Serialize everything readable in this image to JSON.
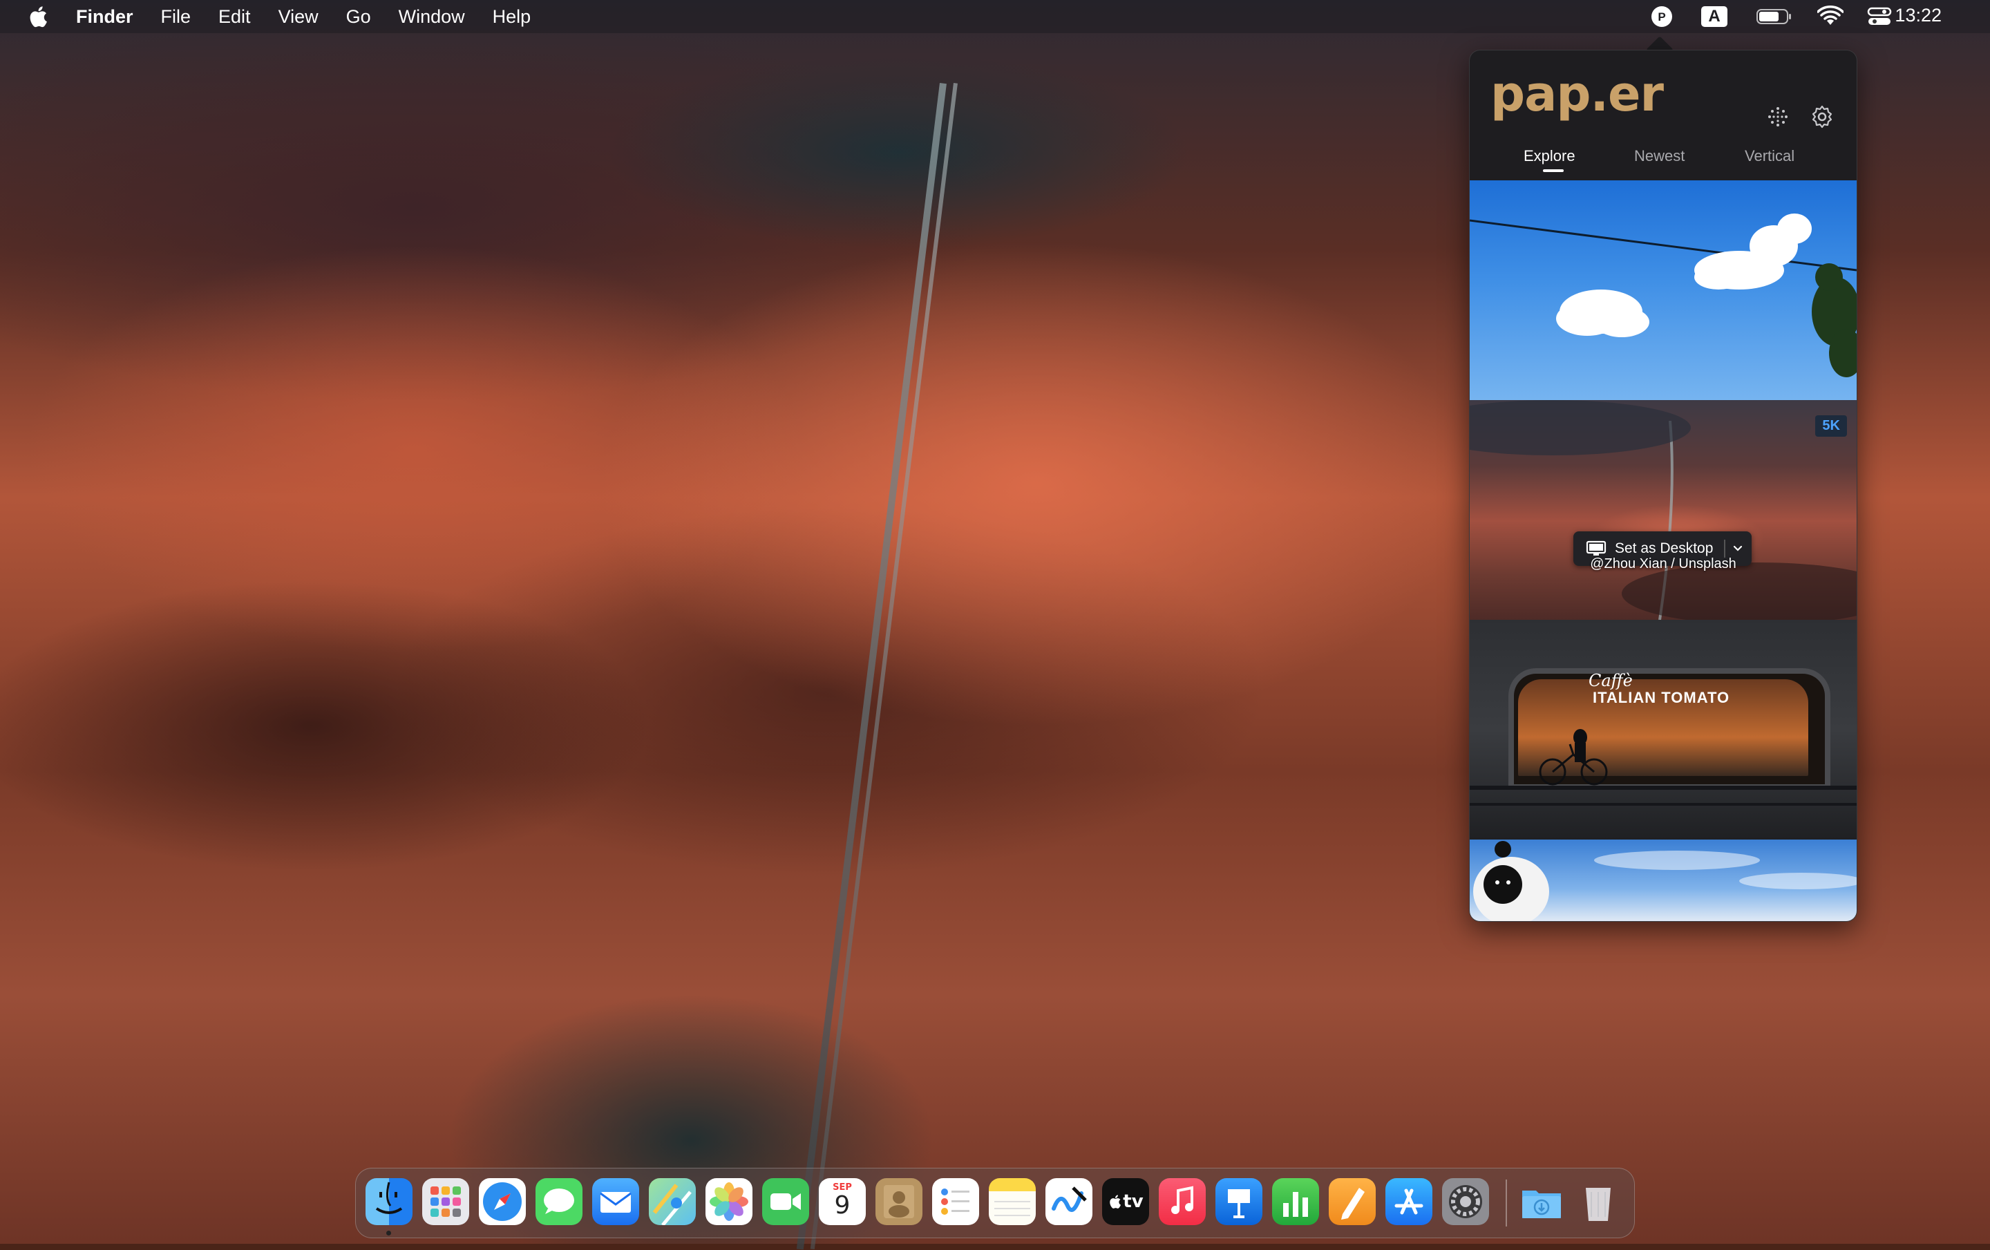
{
  "menubar": {
    "app_name": "Finder",
    "menus": [
      "File",
      "Edit",
      "View",
      "Go",
      "Window",
      "Help"
    ],
    "clock": "13:22",
    "input_source": "A",
    "status_icons": [
      "paper-app-icon",
      "input-source-icon",
      "battery-icon",
      "wifi-icon",
      "control-center-icon"
    ]
  },
  "popover": {
    "logo": "pap.er",
    "tabs": [
      {
        "label": "Explore",
        "active": true
      },
      {
        "label": "Newest",
        "active": false
      },
      {
        "label": "Vertical",
        "active": false
      }
    ],
    "thumbnails": [
      {
        "id": "sky-clouds"
      },
      {
        "id": "red-desert-road",
        "badge": "5K",
        "set_button": "Set as Desktop",
        "credit": "@Zhou Xian / Unsplash"
      },
      {
        "id": "caffe-italian-tomato",
        "sign_script": "Caffè",
        "sign": "ITALIAN TOMATO"
      },
      {
        "id": "sky-toy"
      }
    ]
  },
  "dock": {
    "apps": [
      "Finder",
      "Launchpad",
      "Safari",
      "Messages",
      "Mail",
      "Maps",
      "Photos",
      "FaceTime",
      "Calendar",
      "Contacts",
      "Reminders",
      "Notes",
      "Freeform",
      "TV",
      "Music",
      "Keynote",
      "Numbers",
      "Pages",
      "App Store",
      "System Settings"
    ],
    "calendar": {
      "month": "SEP",
      "day": "9"
    },
    "tv_label": "tv",
    "right": [
      "Downloads",
      "Trash"
    ]
  },
  "colors": {
    "popover_bg": "#1e1d20",
    "logo": "#c9a169",
    "badge_text": "#4da3ff"
  }
}
